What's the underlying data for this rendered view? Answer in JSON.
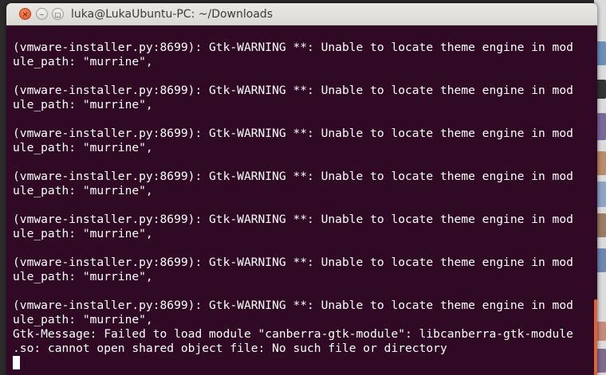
{
  "window": {
    "title": "luka@LukaUbuntu-PC: ~/Downloads",
    "close_glyph": "×",
    "minimize_glyph": "–",
    "maximize_glyph": "□"
  },
  "terminal": {
    "background_color": "#300a24",
    "text_color": "#ffffff",
    "lines": [
      "(vmware-installer.py:8699): Gtk-WARNING **: Unable to locate theme engine in mod",
      "ule_path: \"murrine\",",
      "",
      "(vmware-installer.py:8699): Gtk-WARNING **: Unable to locate theme engine in mod",
      "ule_path: \"murrine\",",
      "",
      "(vmware-installer.py:8699): Gtk-WARNING **: Unable to locate theme engine in mod",
      "ule_path: \"murrine\",",
      "",
      "(vmware-installer.py:8699): Gtk-WARNING **: Unable to locate theme engine in mod",
      "ule_path: \"murrine\",",
      "",
      "(vmware-installer.py:8699): Gtk-WARNING **: Unable to locate theme engine in mod",
      "ule_path: \"murrine\",",
      "",
      "(vmware-installer.py:8699): Gtk-WARNING **: Unable to locate theme engine in mod",
      "ule_path: \"murrine\",",
      "",
      "(vmware-installer.py:8699): Gtk-WARNING **: Unable to locate theme engine in mod",
      "ule_path: \"murrine\",",
      "Gtk-Message: Failed to load module \"canberra-gtk-module\": libcanberra-gtk-module",
      ".so: cannot open shared object file: No such file or directory"
    ]
  },
  "accent_color": "#e0623a"
}
